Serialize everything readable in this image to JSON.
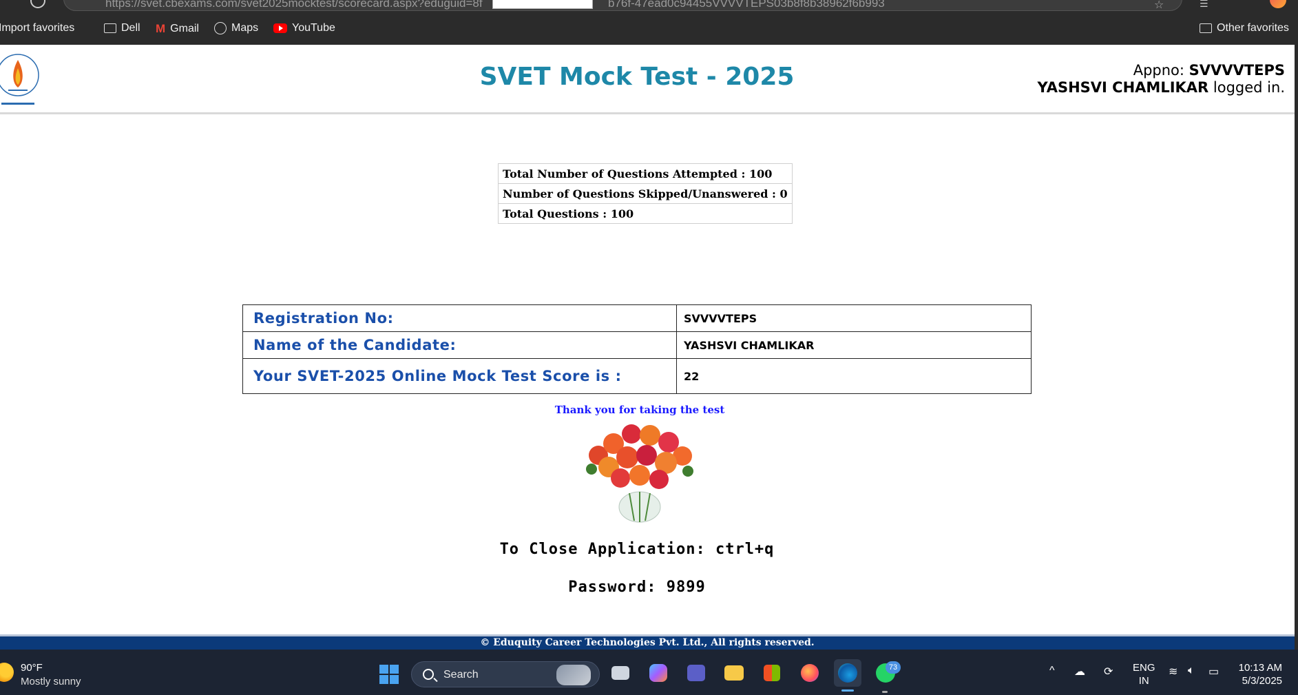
{
  "browser": {
    "url_visible": "https://svet.cbexams.com/svet2025mocktest/scorecard.aspx?eduguid=8f",
    "url_tail": "b76f-47ead0c94455VVVVTEPS03b8f8b38962f6b993",
    "favorites": [
      {
        "label": "Import favorites",
        "icon": "import-icon"
      },
      {
        "label": "Dell",
        "icon": "folder-icon"
      },
      {
        "label": "Gmail",
        "icon": "gmail-icon"
      },
      {
        "label": "Maps",
        "icon": "globe-icon"
      },
      {
        "label": "YouTube",
        "icon": "youtube-icon"
      }
    ],
    "other_favorites": "Other favorites"
  },
  "header": {
    "title": "SVET Mock Test - 2025",
    "appno_label": "Appno:",
    "appno_value": "SVVVVTEPS",
    "user_name": "YASHSVI CHAMLIKAR",
    "logged_in_suffix": "logged in."
  },
  "summary": {
    "attempted": "Total Number of Questions Attempted : 100",
    "skipped": "Number of Questions Skipped/Unanswered : 0",
    "total": "Total Questions : 100"
  },
  "details": {
    "reg_label": "Registration No:",
    "reg_value": "SVVVVTEPS",
    "name_label": "Name of the Candidate:",
    "name_value": "YASHSVI CHAMLIKAR",
    "score_label": "Your SVET-2025 Online Mock Test Score is :",
    "score_value": "22"
  },
  "thanks": "Thank you for taking the test",
  "close_msg": "To Close Application: ctrl+q",
  "password_msg": "Password: 9899",
  "footer": "© Eduquity Career Technologies Pvt. Ltd., All rights reserved.",
  "taskbar": {
    "weather_temp": "90°F",
    "weather_desc": "Mostly sunny",
    "search_label": "Search",
    "whatsapp_badge": "73",
    "lang_line1": "ENG",
    "lang_line2": "IN",
    "time": "10:13 AM",
    "date": "5/3/2025"
  },
  "colors": {
    "title": "#1e88a8",
    "label_blue": "#1a4faa",
    "thanks_blue": "#1a1aff",
    "footer_bg": "#0b3a7a"
  }
}
